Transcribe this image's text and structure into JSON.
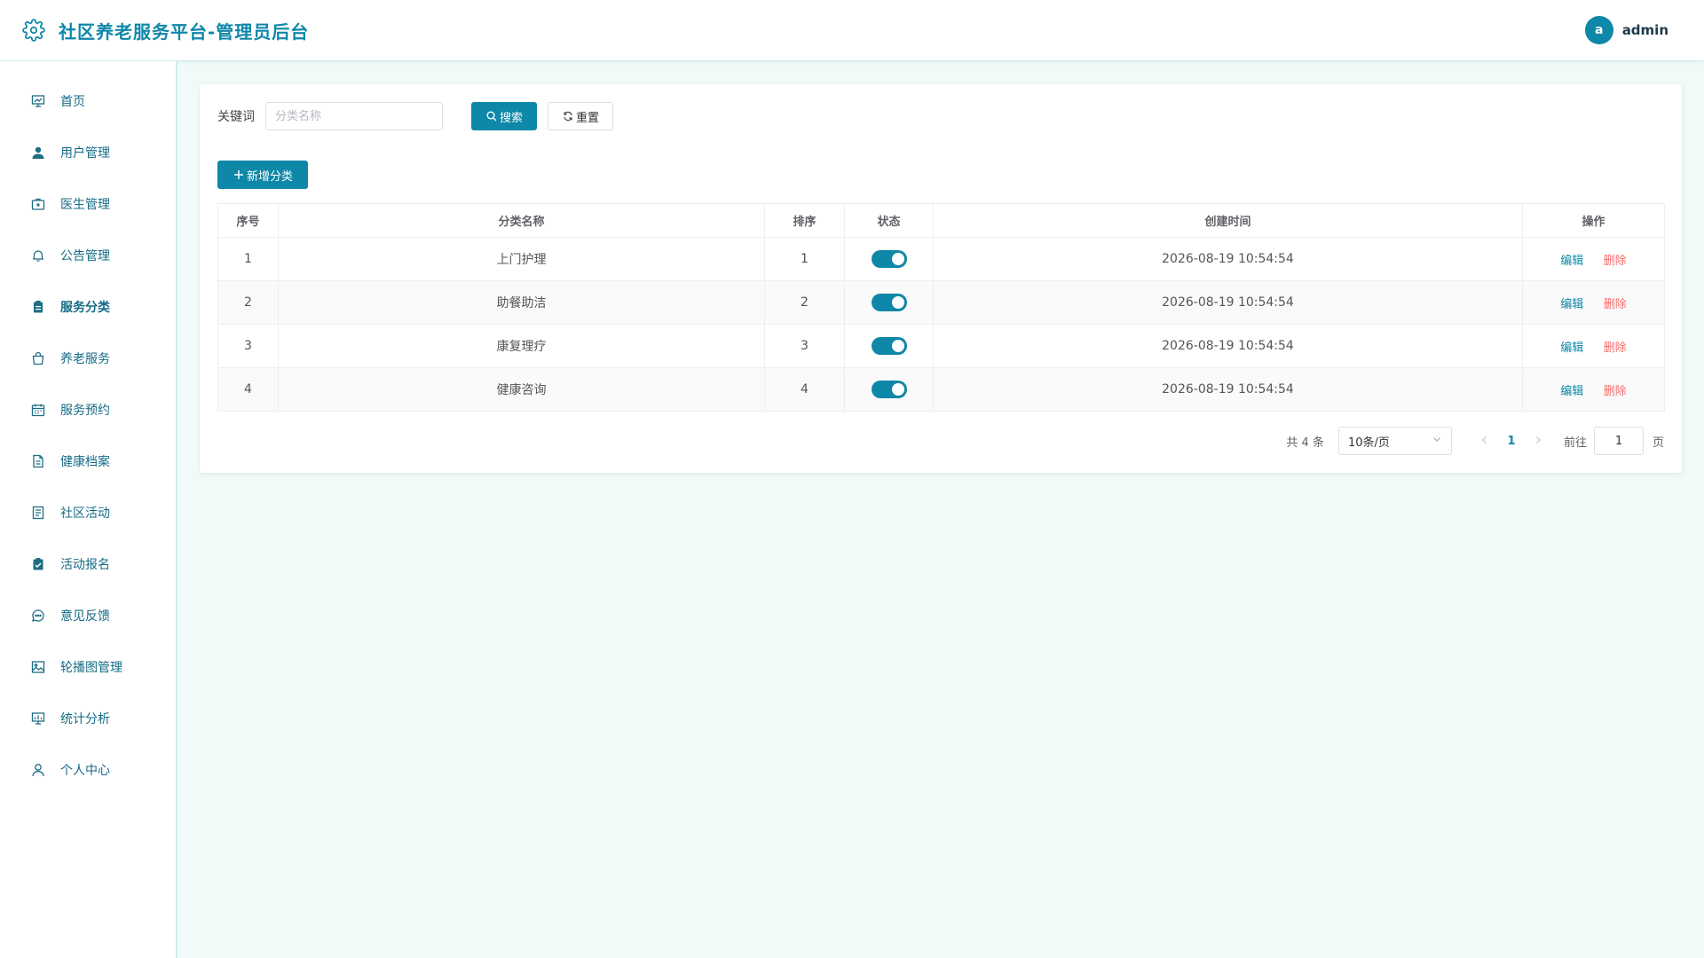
{
  "header": {
    "title": "社区养老服务平台-管理员后台",
    "avatar_letter": "a",
    "username": "admin"
  },
  "sidebar": {
    "items": [
      {
        "label": "首页",
        "icon": "dashboard-icon"
      },
      {
        "label": "用户管理",
        "icon": "user-icon"
      },
      {
        "label": "医生管理",
        "icon": "medical-kit-icon"
      },
      {
        "label": "公告管理",
        "icon": "bell-icon"
      },
      {
        "label": "服务分类",
        "icon": "clipboard-icon",
        "active": true
      },
      {
        "label": "养老服务",
        "icon": "shopping-bag-icon"
      },
      {
        "label": "服务预约",
        "icon": "calendar-icon"
      },
      {
        "label": "健康档案",
        "icon": "document-icon"
      },
      {
        "label": "社区活动",
        "icon": "tickets-icon"
      },
      {
        "label": "活动报名",
        "icon": "checklist-icon"
      },
      {
        "label": "意见反馈",
        "icon": "chat-icon"
      },
      {
        "label": "轮播图管理",
        "icon": "picture-icon"
      },
      {
        "label": "统计分析",
        "icon": "presentation-icon"
      },
      {
        "label": "个人中心",
        "icon": "person-icon"
      }
    ]
  },
  "search": {
    "label": "关键词",
    "placeholder": "分类名称",
    "value": "",
    "search_button": "搜索",
    "reset_button": "重置"
  },
  "toolbar": {
    "add_button": "新增分类"
  },
  "table": {
    "columns": [
      "序号",
      "分类名称",
      "排序",
      "状态",
      "创建时间",
      "操作"
    ],
    "rows": [
      {
        "index": "1",
        "name": "上门护理",
        "sort": "1",
        "enabled": true,
        "created": "2026-08-19 10:54:54"
      },
      {
        "index": "2",
        "name": "助餐助洁",
        "sort": "2",
        "enabled": true,
        "created": "2026-08-19 10:54:54"
      },
      {
        "index": "3",
        "name": "康复理疗",
        "sort": "3",
        "enabled": true,
        "created": "2026-08-19 10:54:54"
      },
      {
        "index": "4",
        "name": "健康咨询",
        "sort": "4",
        "enabled": true,
        "created": "2026-08-19 10:54:54"
      }
    ],
    "edit_label": "编辑",
    "delete_label": "删除"
  },
  "pagination": {
    "total_text": "共 4 条",
    "page_size": "10条/页",
    "current_page": "1",
    "goto_label": "前往",
    "goto_value": "1",
    "goto_suffix": "页"
  },
  "colors": {
    "accent": "#0e87a8",
    "danger": "#f56c6c",
    "background": "#f0fbf9"
  }
}
